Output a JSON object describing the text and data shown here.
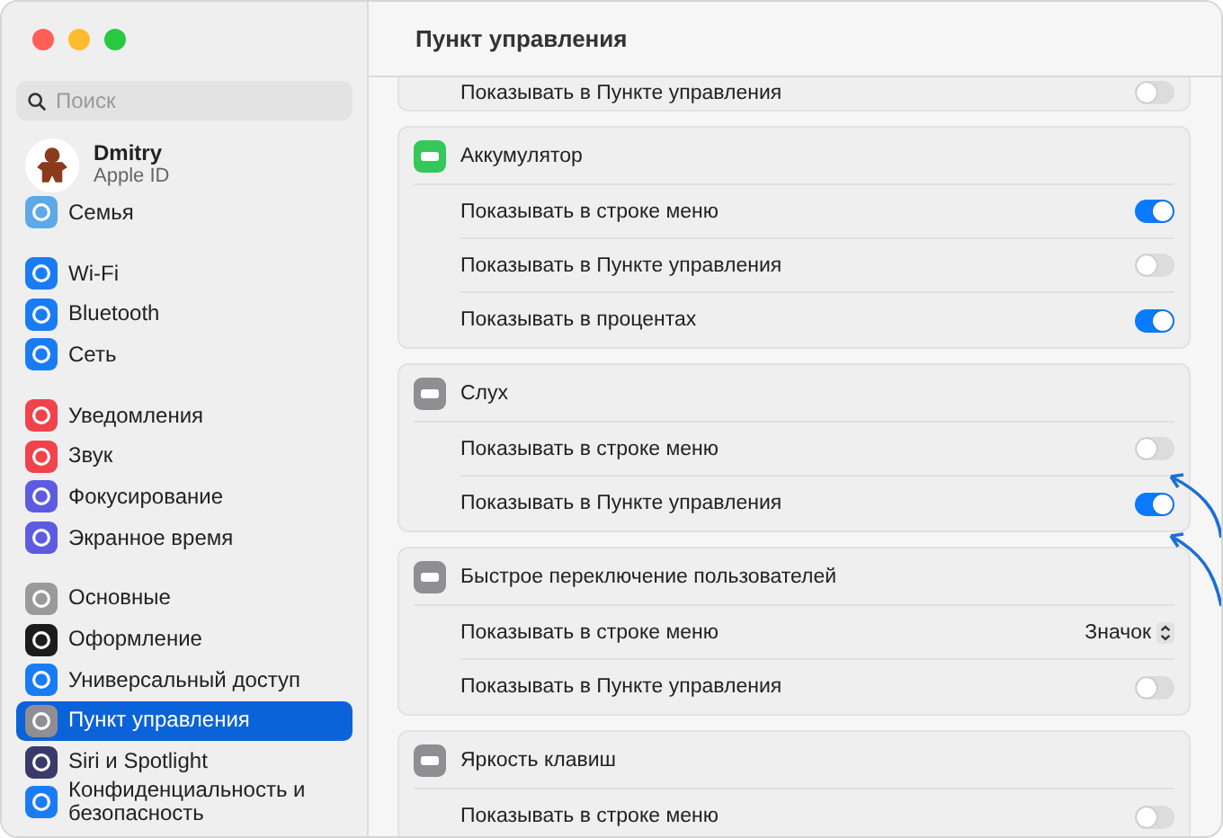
{
  "window": {
    "traffic_lights": [
      {
        "color": "#ff5f57"
      },
      {
        "color": "#febc2e"
      },
      {
        "color": "#28c840"
      }
    ]
  },
  "search": {
    "placeholder": "Поиск"
  },
  "profile": {
    "name": "Dmitry",
    "subtitle": "Apple ID"
  },
  "sidebar": {
    "groups": [
      [
        {
          "label": "Семья",
          "color": "#5ea8e8",
          "selected": false
        }
      ],
      [
        {
          "label": "Wi-Fi",
          "color": "#1a7cf5",
          "selected": false
        },
        {
          "label": "Bluetooth",
          "color": "#1a7cf5",
          "selected": false
        },
        {
          "label": "Сеть",
          "color": "#1a7cf5",
          "selected": false
        }
      ],
      [
        {
          "label": "Уведомления",
          "color": "#f0434b",
          "selected": false
        },
        {
          "label": "Звук",
          "color": "#f0434b",
          "selected": false
        },
        {
          "label": "Фокусирование",
          "color": "#5d5ce0",
          "selected": false
        },
        {
          "label": "Экранное время",
          "color": "#5d5ce0",
          "selected": false
        }
      ],
      [
        {
          "label": "Основные",
          "color": "#9a9a9a",
          "selected": false
        },
        {
          "label": "Оформление",
          "color": "#1c1c1c",
          "selected": false
        },
        {
          "label": "Универсальный доступ",
          "color": "#1a7cf5",
          "selected": false
        },
        {
          "label": "Пункт управления",
          "color": "#8e8e93",
          "selected": true
        },
        {
          "label": "Siri и Spotlight",
          "color": "#3a3a6a",
          "selected": false
        },
        {
          "label": "Конфиденциальность и безопасность",
          "color": "#1a7cf5",
          "selected": false
        }
      ]
    ]
  },
  "main": {
    "title": "Пункт управления",
    "sections": [
      {
        "cut": true,
        "rows": [
          {
            "kind": "toggle",
            "label": "Показывать в Пункте управления",
            "on": false
          }
        ]
      },
      {
        "title": "Аккумулятор",
        "color": "#34c759",
        "rows": [
          {
            "kind": "toggle",
            "label": "Показывать в строке меню",
            "on": true
          },
          {
            "kind": "toggle",
            "label": "Показывать в Пункте управления",
            "on": false
          },
          {
            "kind": "toggle",
            "label": "Показывать в процентах",
            "on": true
          }
        ]
      },
      {
        "title": "Слух",
        "color": "#8e8e93",
        "rows": [
          {
            "kind": "toggle",
            "label": "Показывать в строке меню",
            "on": false
          },
          {
            "kind": "toggle",
            "label": "Показывать в Пункте управления",
            "on": true
          }
        ]
      },
      {
        "title": "Быстрое переключение пользователей",
        "color": "#8e8e93",
        "rows": [
          {
            "kind": "popup",
            "label": "Показывать в строке меню",
            "value": "Значок"
          },
          {
            "kind": "toggle",
            "label": "Показывать в Пункте управления",
            "on": false
          }
        ]
      },
      {
        "title": "Яркость клавиш",
        "color": "#8e8e93",
        "rows": [
          {
            "kind": "toggle",
            "label": "Показывать в строке меню",
            "on": false
          }
        ]
      }
    ]
  }
}
